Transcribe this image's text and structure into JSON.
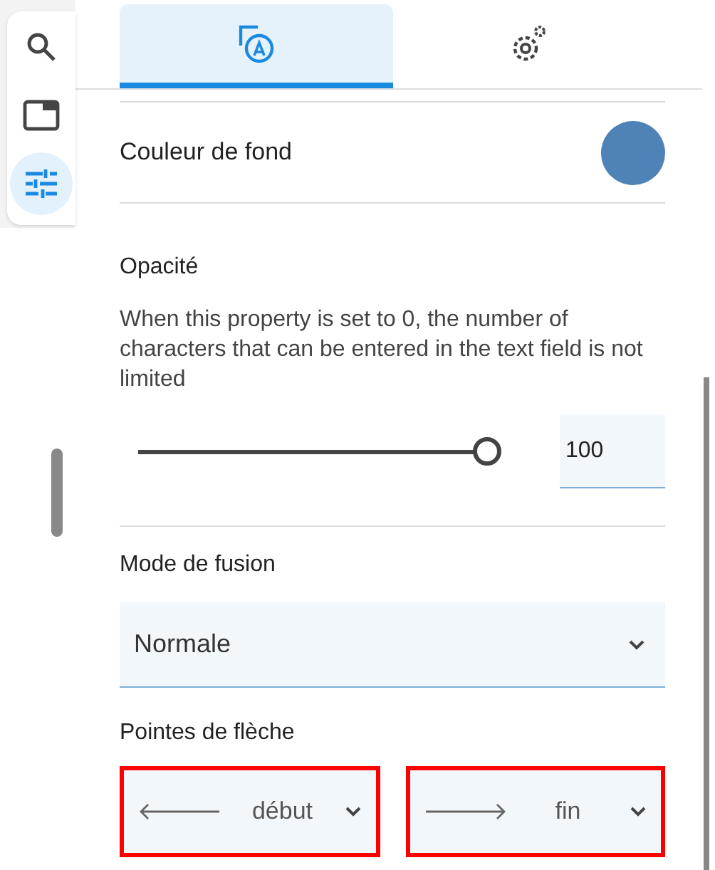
{
  "toolbar": [
    {
      "kind": "search",
      "selected": false
    },
    {
      "kind": "panel",
      "selected": false
    },
    {
      "kind": "sliders",
      "selected": true
    }
  ],
  "tabs": [
    {
      "kind": "style",
      "selected": true
    },
    {
      "kind": "settings",
      "selected": false
    }
  ],
  "background_color": {
    "label": "Couleur de fond",
    "color": "#4f83b8"
  },
  "opacity": {
    "label": "Opacité",
    "description": "When this property is set to 0, the number of characters that can be entered in the text field is not limited",
    "level": 1,
    "value": "100"
  },
  "blend_mode": {
    "label": "Mode de fusion",
    "value": "Normale"
  },
  "arrowheads": {
    "label": "Pointes de flèche",
    "selects": [
      {
        "kind": "start",
        "value": "début",
        "highlighted": true
      },
      {
        "kind": "end",
        "value": "fin",
        "highlighted": true
      }
    ]
  }
}
